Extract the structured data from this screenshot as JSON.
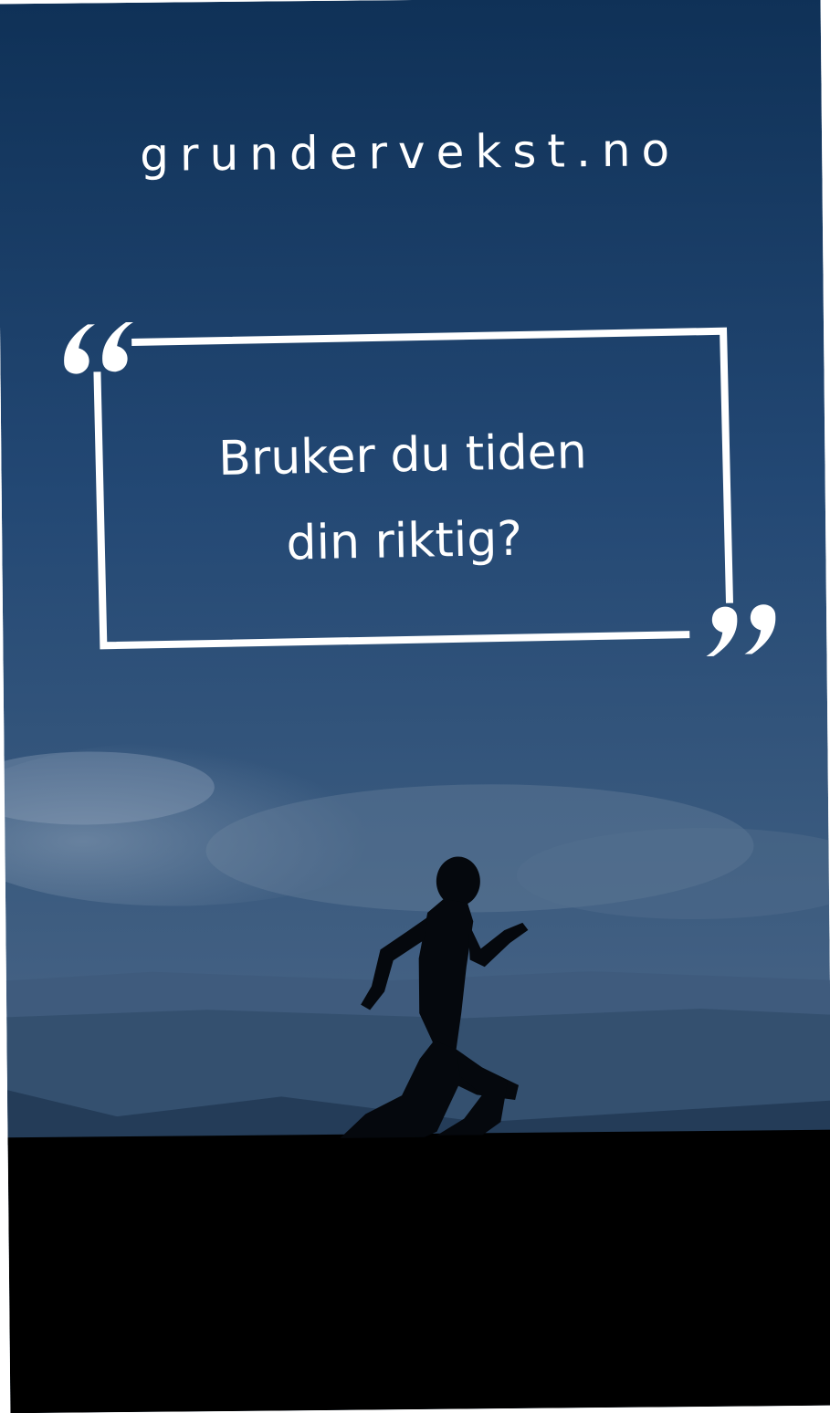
{
  "site": {
    "title": "grundervekst.no"
  },
  "quote": {
    "line1": "Bruker du tiden",
    "line2": "din riktig?",
    "open_mark_icon": "open-quote-icon",
    "close_mark_icon": "close-quote-icon"
  },
  "colors": {
    "sky_top": "#0f3157",
    "sky_mid": "#2f5379",
    "sky_low": "#5f7693",
    "ground": "#000000",
    "text": "#ffffff"
  }
}
